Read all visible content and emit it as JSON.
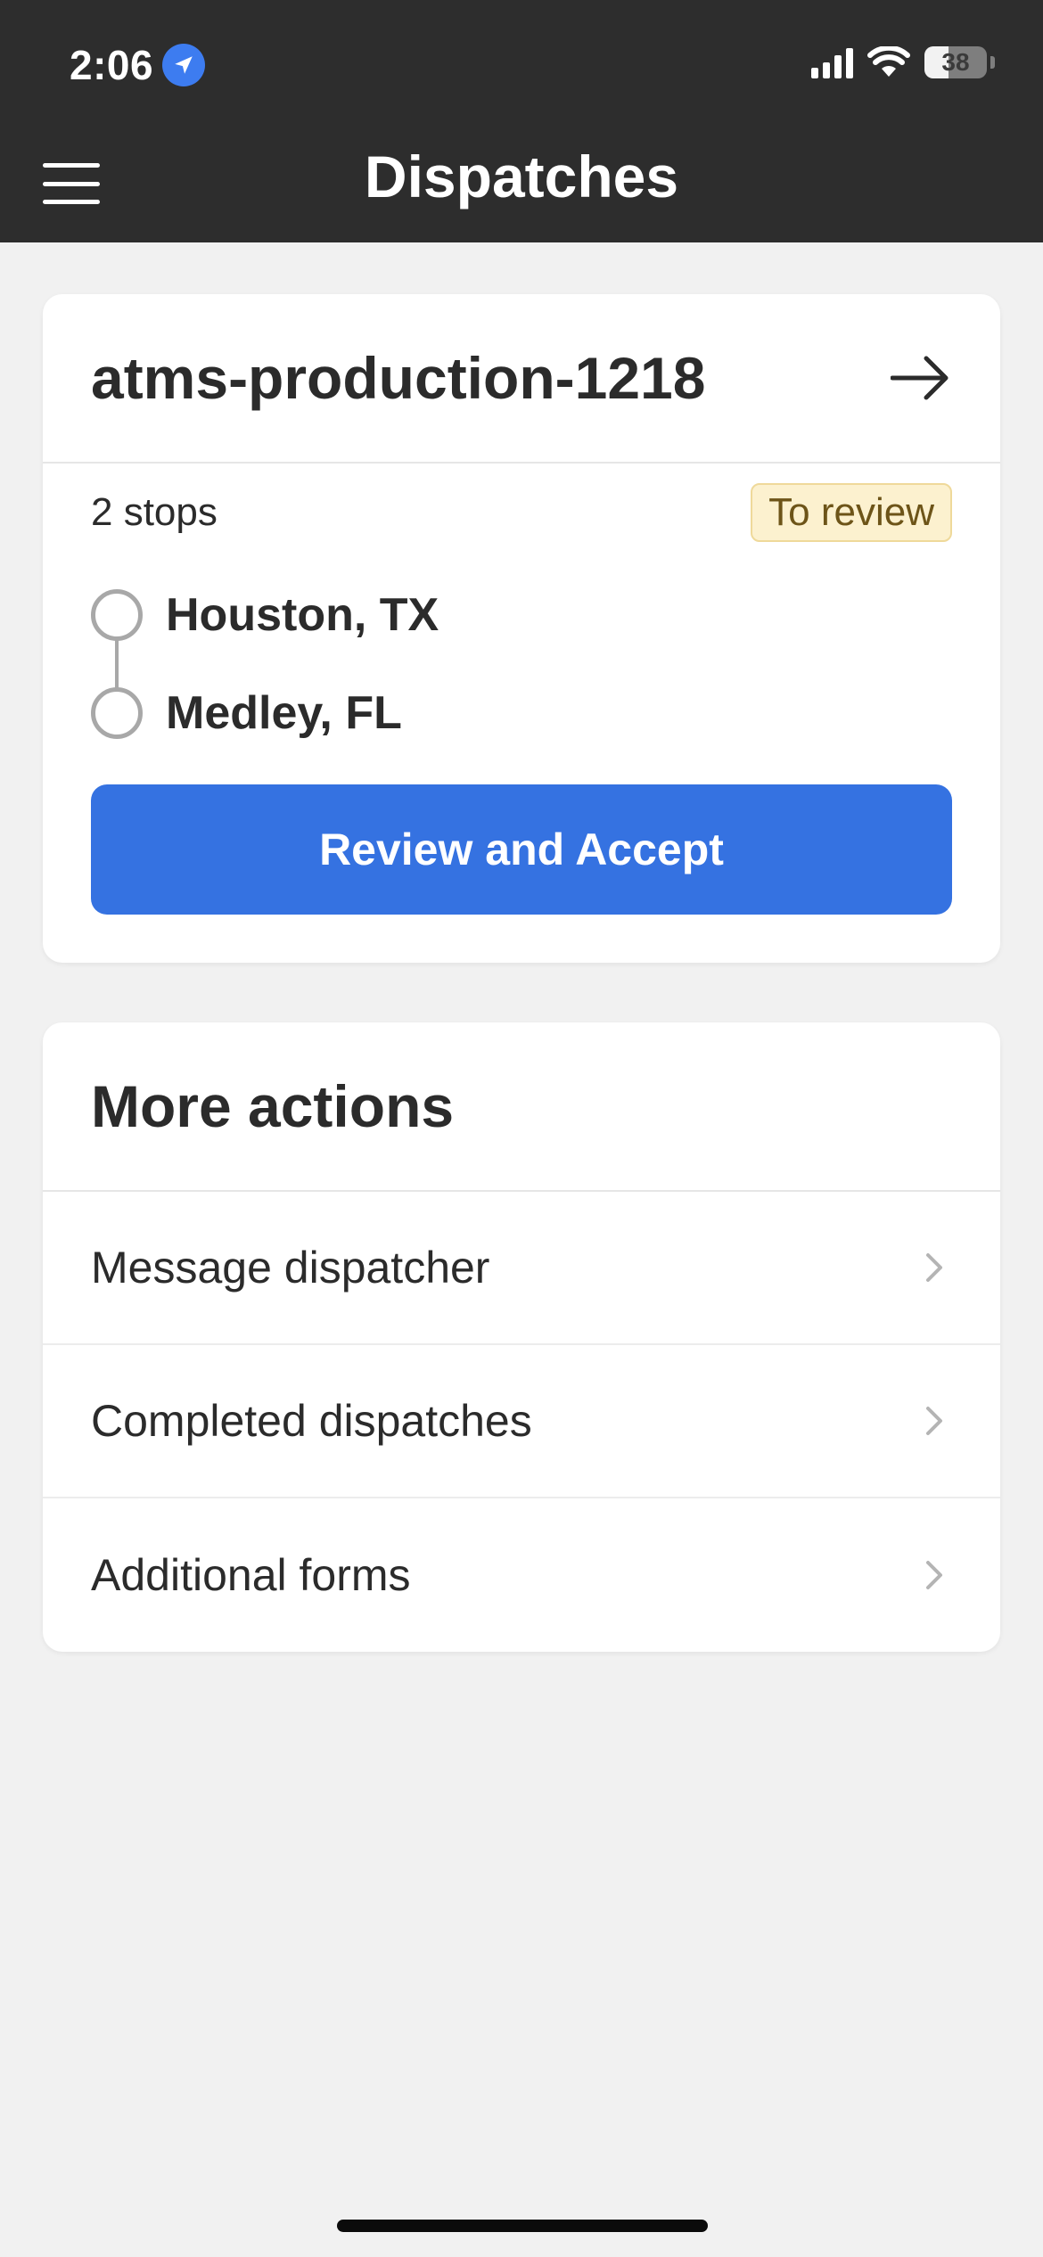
{
  "status_bar": {
    "time": "2:06",
    "battery_percent": "38",
    "battery_level": 0.38
  },
  "nav": {
    "title": "Dispatches",
    "menu_icon": "hamburger-menu-icon"
  },
  "dispatch": {
    "id": "atms-production-1218",
    "stops_label": "2 stops",
    "status_badge": "To review",
    "stops": [
      "Houston, TX",
      "Medley, FL"
    ],
    "primary_action": "Review and Accept"
  },
  "more_actions": {
    "title": "More actions",
    "items": [
      "Message dispatcher",
      "Completed dispatches",
      "Additional forms"
    ]
  },
  "colors": {
    "header_bg": "#2d2d2d",
    "primary_button": "#3572e1",
    "badge_bg": "#fcf1cf",
    "badge_text": "#6d5418",
    "page_bg": "#f1f1f1"
  }
}
